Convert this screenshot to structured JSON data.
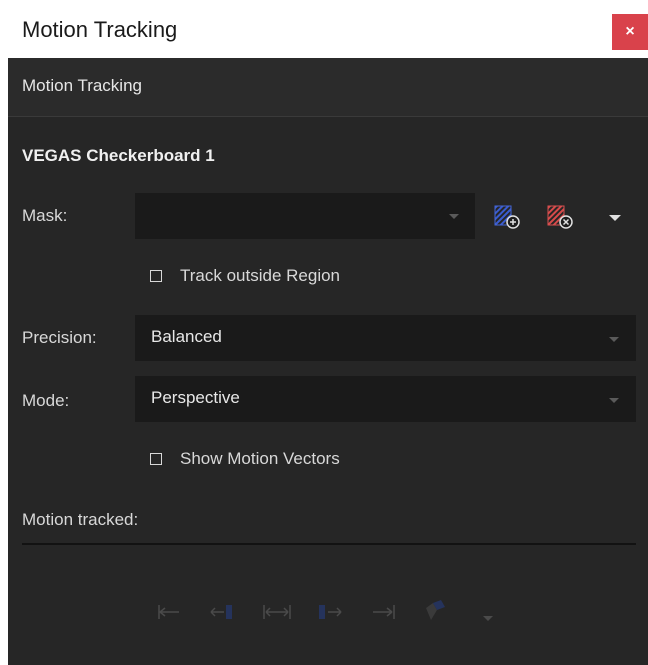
{
  "window": {
    "title": "Motion Tracking",
    "close_label": "×"
  },
  "panel": {
    "header": "Motion Tracking",
    "effect_name": "VEGAS Checkerboard 1",
    "mask": {
      "label": "Mask:",
      "value": ""
    },
    "track_outside_region": {
      "label": "Track outside Region",
      "checked": false
    },
    "precision": {
      "label": "Precision:",
      "value": "Balanced"
    },
    "mode": {
      "label": "Mode:",
      "value": "Perspective"
    },
    "show_motion_vectors": {
      "label": "Show Motion Vectors",
      "checked": false
    },
    "motion_tracked": {
      "label": "Motion tracked:"
    },
    "icons": {
      "add_mask": "add-mask-icon",
      "remove_mask": "remove-mask-icon",
      "mask_menu": "chevron-down-icon",
      "track_to_start": "track-to-start-icon",
      "track_backward": "track-backward-icon",
      "track_both": "track-both-directions-icon",
      "track_forward": "track-forward-icon",
      "track_to_end": "track-to-end-icon",
      "options": "tracking-options-icon"
    },
    "colors": {
      "accent_blue": "#3a5cd0",
      "danger_red": "#d84a4a",
      "close_red": "#d9424b"
    }
  }
}
